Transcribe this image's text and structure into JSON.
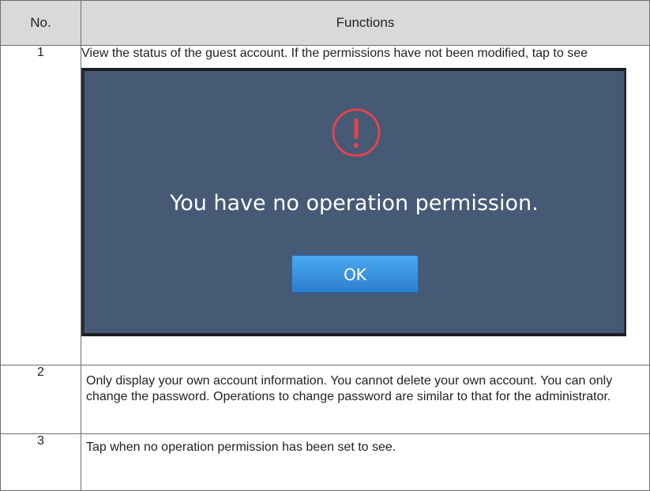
{
  "table": {
    "header": {
      "no": "No.",
      "functions": "Functions"
    },
    "rows": [
      {
        "no": "1",
        "text": "View the status of the guest account. If the permissions have not been modified, tap to see",
        "dialog": {
          "icon": "exclamation-circle-icon",
          "message": "You have no operation permission.",
          "ok_label": "OK",
          "colors": {
            "background": "#465a76",
            "icon": "#e0454f",
            "button": "#3a93e2"
          }
        }
      },
      {
        "no": "2",
        "text": "Only display your own account information. You cannot delete your own account. You can only change the password. Operations to change password are similar to that for the administrator."
      },
      {
        "no": "3",
        "text": "Tap when no operation permission has been set to see."
      }
    ]
  }
}
